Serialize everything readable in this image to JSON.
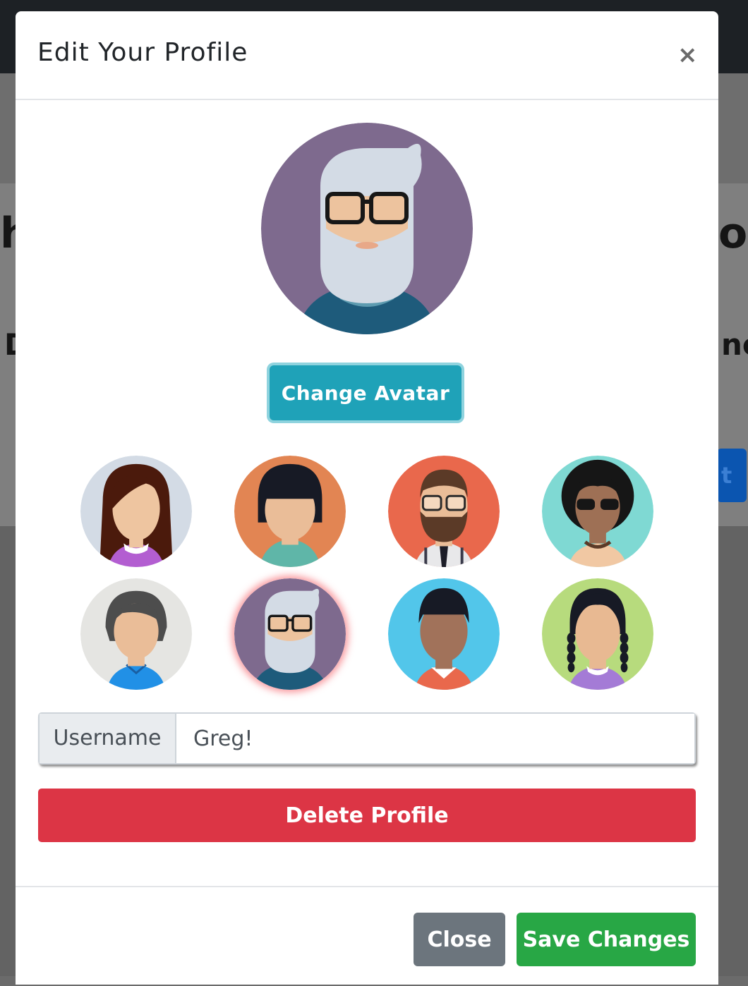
{
  "modal": {
    "title": "Edit Your Profile",
    "close_icon": "×",
    "change_avatar_label": "Change Avatar",
    "username_label": "Username",
    "username_value": "Greg!",
    "delete_label": "Delete Profile",
    "close_label": "Close",
    "save_label": "Save Changes",
    "selected_avatar": "old-man-glasses"
  },
  "avatars": [
    "woman-long-hair",
    "woman-bob-hair",
    "bearded-man-glasses",
    "afro-sunglasses",
    "short-hair-person",
    "old-man-glasses",
    "man-flat-top",
    "girl-braids"
  ],
  "colors": {
    "change_avatar": "#1fa2b8",
    "delete": "#dc3545",
    "close": "#6c757d",
    "save": "#28a745",
    "selected_glow": "#f44a54"
  }
}
